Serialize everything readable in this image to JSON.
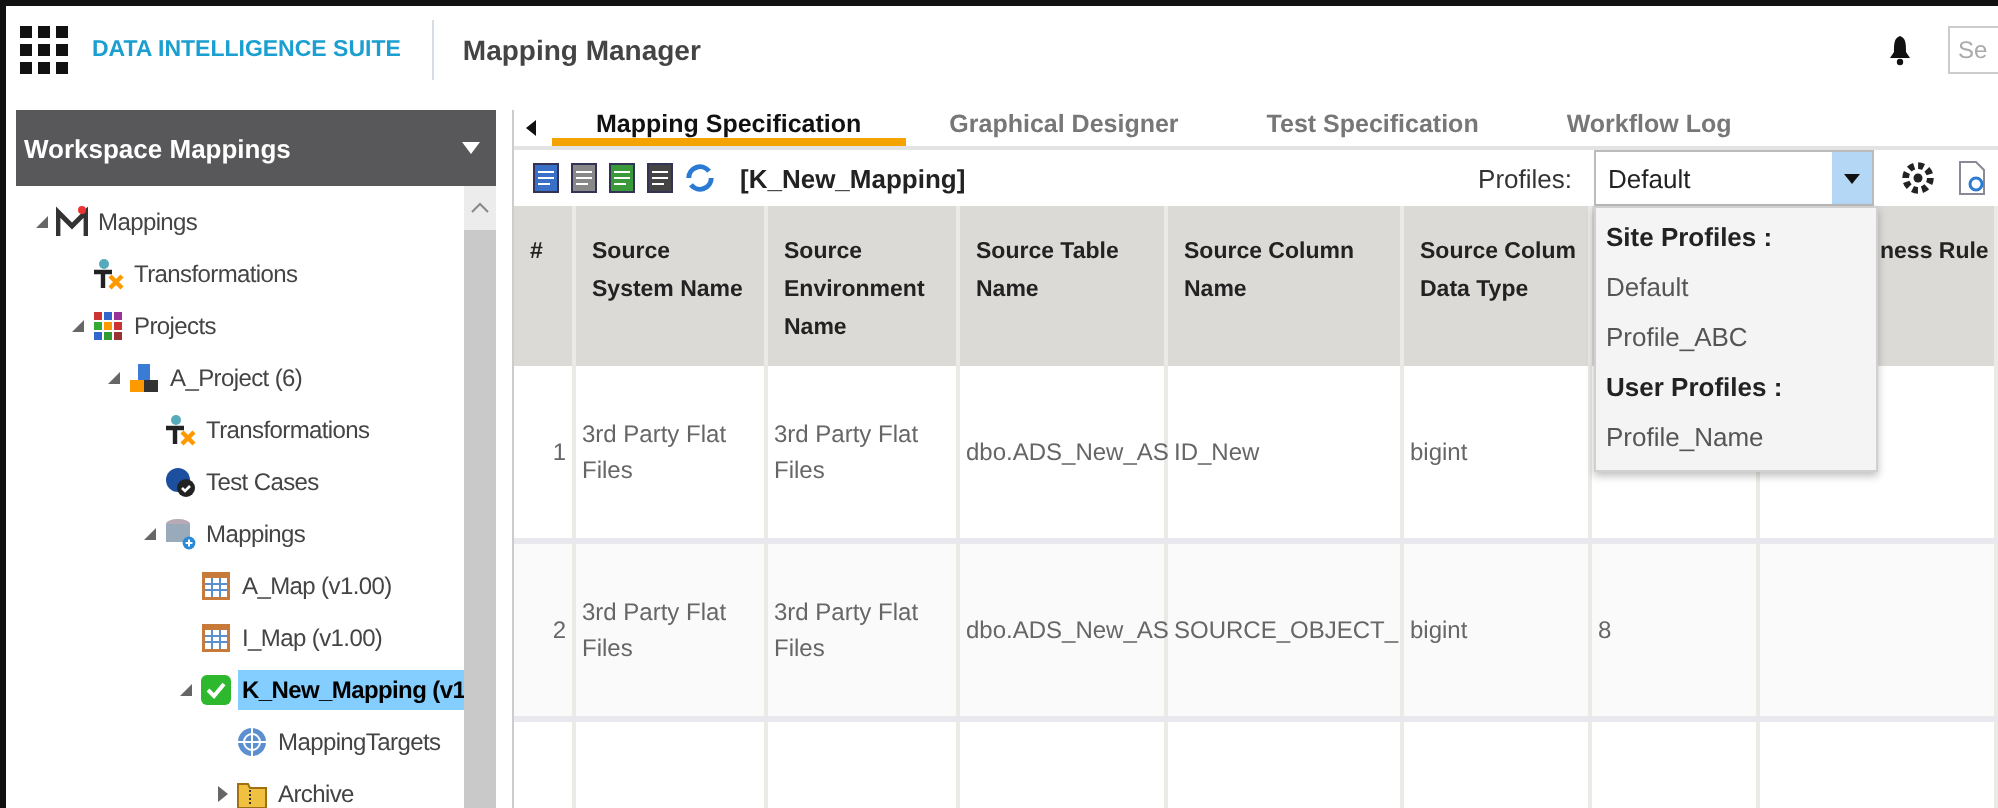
{
  "header": {
    "brand": "DATA INTELLIGENCE SUITE",
    "title": "Mapping Manager",
    "search": {
      "placeholder": "Se"
    }
  },
  "sidebar": {
    "title": "Workspace Mappings",
    "tree": [
      {
        "label": "Mappings",
        "kind": "root",
        "expanded": true,
        "selected": false,
        "children": [
          {
            "label": "Transformations",
            "kind": "transform",
            "selected": false
          },
          {
            "label": "Projects",
            "kind": "projects",
            "expanded": true,
            "selected": false,
            "children": [
              {
                "label": "A_Project (6)",
                "kind": "project",
                "expanded": true,
                "selected": false,
                "children": [
                  {
                    "label": "Transformations",
                    "kind": "transform",
                    "selected": false
                  },
                  {
                    "label": "Test Cases",
                    "kind": "testcase",
                    "selected": false
                  },
                  {
                    "label": "Mappings",
                    "kind": "database",
                    "expanded": true,
                    "selected": false,
                    "children": [
                      {
                        "label": "A_Map (v1.00)",
                        "kind": "map",
                        "selected": false
                      },
                      {
                        "label": "I_Map (v1.00)",
                        "kind": "map",
                        "selected": false
                      },
                      {
                        "label": "K_New_Mapping (v1",
                        "kind": "check",
                        "expanded": true,
                        "selected": true,
                        "children": [
                          {
                            "label": "MappingTargets",
                            "kind": "target",
                            "selected": false
                          },
                          {
                            "label": "Archive",
                            "kind": "folder",
                            "expanded": false,
                            "selected": false
                          }
                        ]
                      }
                    ]
                  }
                ]
              }
            ]
          }
        ]
      }
    ]
  },
  "tabs": [
    {
      "label": "Mapping Specification",
      "selected": true
    },
    {
      "label": "Graphical Designer",
      "selected": false
    },
    {
      "label": "Test Specification",
      "selected": false
    },
    {
      "label": "Workflow Log",
      "selected": false
    }
  ],
  "toolbar": {
    "mapping_name": "[K_New_Mapping]",
    "profiles": {
      "label": "Profiles:",
      "value": "Default",
      "expanded": true,
      "options": [
        {
          "kind": "group",
          "label": "Site Profiles :"
        },
        {
          "kind": "option",
          "label": "Default"
        },
        {
          "kind": "option",
          "label": "Profile_ABC"
        },
        {
          "kind": "group",
          "label": "User Profiles :"
        },
        {
          "kind": "option",
          "label": "Profile_Name"
        }
      ]
    }
  },
  "table": {
    "columns": [
      "#",
      "Source System Name",
      "Source Environment Name",
      "Source Table Name",
      "Source Column Name",
      "Source Colum Data Type",
      "",
      "ness Rule"
    ],
    "rows": [
      [
        "1",
        "3rd Party Flat Files",
        "3rd Party Flat Files",
        "dbo.ADS_New_AS",
        "ID_New",
        "bigint",
        "",
        ""
      ],
      [
        "2",
        "3rd Party Flat Files",
        "3rd Party Flat Files",
        "dbo.ADS_New_AS",
        "SOURCE_OBJECT_",
        "bigint",
        "8",
        ""
      ]
    ]
  }
}
